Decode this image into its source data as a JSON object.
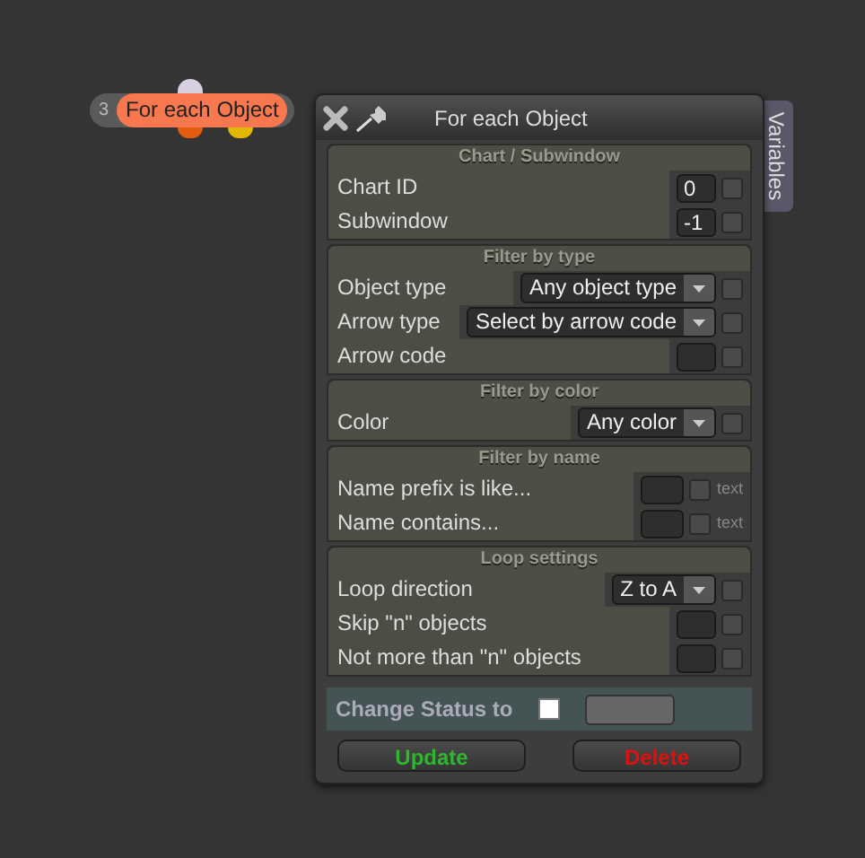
{
  "node": {
    "number": "3",
    "title": "For each Object"
  },
  "window": {
    "title": "For each Object",
    "side_tab": "Variables"
  },
  "sections": [
    {
      "title": "Chart / Subwindow",
      "rows": [
        {
          "label": "Chart ID",
          "kind": "input",
          "value": "0",
          "checked": false
        },
        {
          "label": "Subwindow",
          "kind": "input",
          "value": "-1",
          "checked": false
        }
      ]
    },
    {
      "title": "Filter by type",
      "rows": [
        {
          "label": "Object type",
          "kind": "dropdown",
          "value": "Any object type",
          "checked": false
        },
        {
          "label": "Arrow type",
          "kind": "dropdown",
          "value": "Select by arrow code",
          "checked": false
        },
        {
          "label": "Arrow code",
          "kind": "input",
          "checked": false
        }
      ]
    },
    {
      "title": "Filter by color",
      "rows": [
        {
          "label": "Color",
          "kind": "dropdown",
          "value": "Any color",
          "checked": false
        }
      ]
    },
    {
      "title": "Filter by name",
      "rows": [
        {
          "label": "Name prefix is like...",
          "kind": "text",
          "suffix": "text",
          "checked": false
        },
        {
          "label": "Name contains...",
          "kind": "text",
          "suffix": "text",
          "checked": false
        }
      ]
    },
    {
      "title": "Loop settings",
      "rows": [
        {
          "label": "Loop direction",
          "kind": "dropdown",
          "value": "Z to A",
          "checked": false
        },
        {
          "label": "Skip \"n\" objects",
          "kind": "input",
          "checked": false
        },
        {
          "label": "Not more than \"n\" objects",
          "kind": "input",
          "checked": false
        }
      ]
    }
  ],
  "status": {
    "label": "Change Status to",
    "checked": false
  },
  "buttons": [
    {
      "label": "Update",
      "kind": "update"
    },
    {
      "label": "Delete",
      "kind": "delete"
    }
  ]
}
